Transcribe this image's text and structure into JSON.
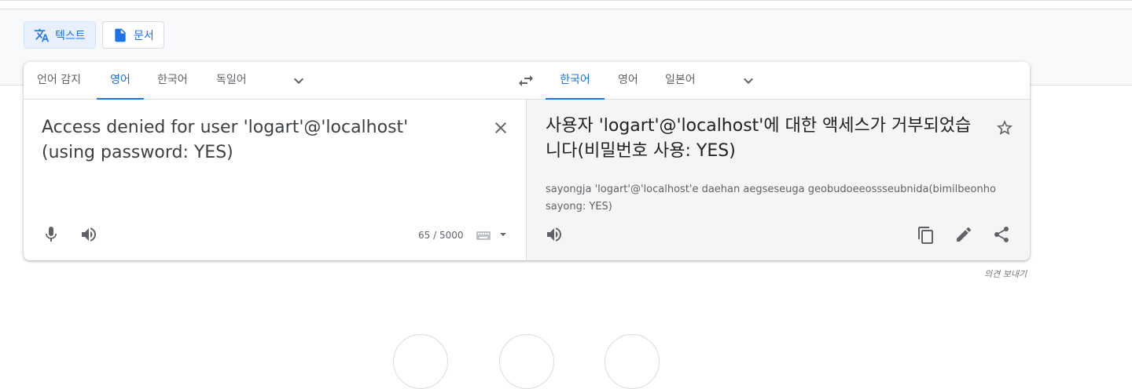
{
  "modes": [
    {
      "label": "텍스트",
      "icon": "translate-icon",
      "active": true
    },
    {
      "label": "문서",
      "icon": "document-icon",
      "active": false
    }
  ],
  "source": {
    "tabs": [
      "언어 감지",
      "영어",
      "한국어",
      "독일어"
    ],
    "selected_tab": 1,
    "text": "Access denied for user 'logart'@'localhost' (using password: YES)",
    "char_count": "65 / 5000"
  },
  "target": {
    "tabs": [
      "한국어",
      "영어",
      "일본어"
    ],
    "selected_tab": 0,
    "text": "사용자 'logart'@'localhost'에 대한 액세스가 거부되었습니다(비밀번호 사용: YES)",
    "romanization": "sayongja 'logart'@'localhost'e daehan aegseseuga geobudoeeossseubnida(bimilbeonho sayong: YES)"
  },
  "feedback_label": "의견 보내기",
  "colors": {
    "accent": "#1a73e8",
    "icon_gray": "#5f6368",
    "target_bg": "#f5f5f5"
  }
}
